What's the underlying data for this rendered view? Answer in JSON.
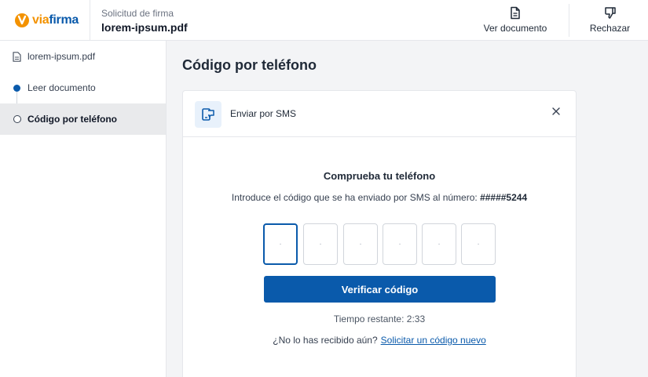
{
  "brand": {
    "via": "via",
    "firma": "firma",
    "colors": {
      "orange": "#f39200",
      "blue": "#0a5aab"
    }
  },
  "header": {
    "subtitle": "Solicitud de firma",
    "document_name": "lorem-ipsum.pdf",
    "actions": [
      {
        "label": "Ver documento",
        "icon": "document-icon"
      },
      {
        "label": "Rechazar",
        "icon": "thumbs-down-icon"
      }
    ]
  },
  "sidebar": {
    "items": [
      {
        "label": "lorem-ipsum.pdf",
        "icon": "file-icon",
        "state": "file"
      },
      {
        "label": "Leer documento",
        "icon": "step-complete-dot",
        "state": "done"
      },
      {
        "label": "Código por teléfono",
        "icon": "step-current-dot",
        "state": "active"
      }
    ]
  },
  "main": {
    "title": "Código por teléfono",
    "method": {
      "label": "Enviar por SMS",
      "icon": "sms-phone-icon"
    },
    "check_title": "Comprueba tu teléfono",
    "description": "Introduce el código que se ha enviado por SMS al número: ",
    "phone_masked": "#####5244",
    "code_digits": [
      "",
      "",
      "",
      "",
      "",
      ""
    ],
    "code_placeholder": "·",
    "verify_label": "Verificar código",
    "timer_text": "Tiempo restante: 2:33",
    "resend_prompt": "¿No lo has recibido aún?",
    "resend_link": "Solicitar un código nuevo"
  }
}
